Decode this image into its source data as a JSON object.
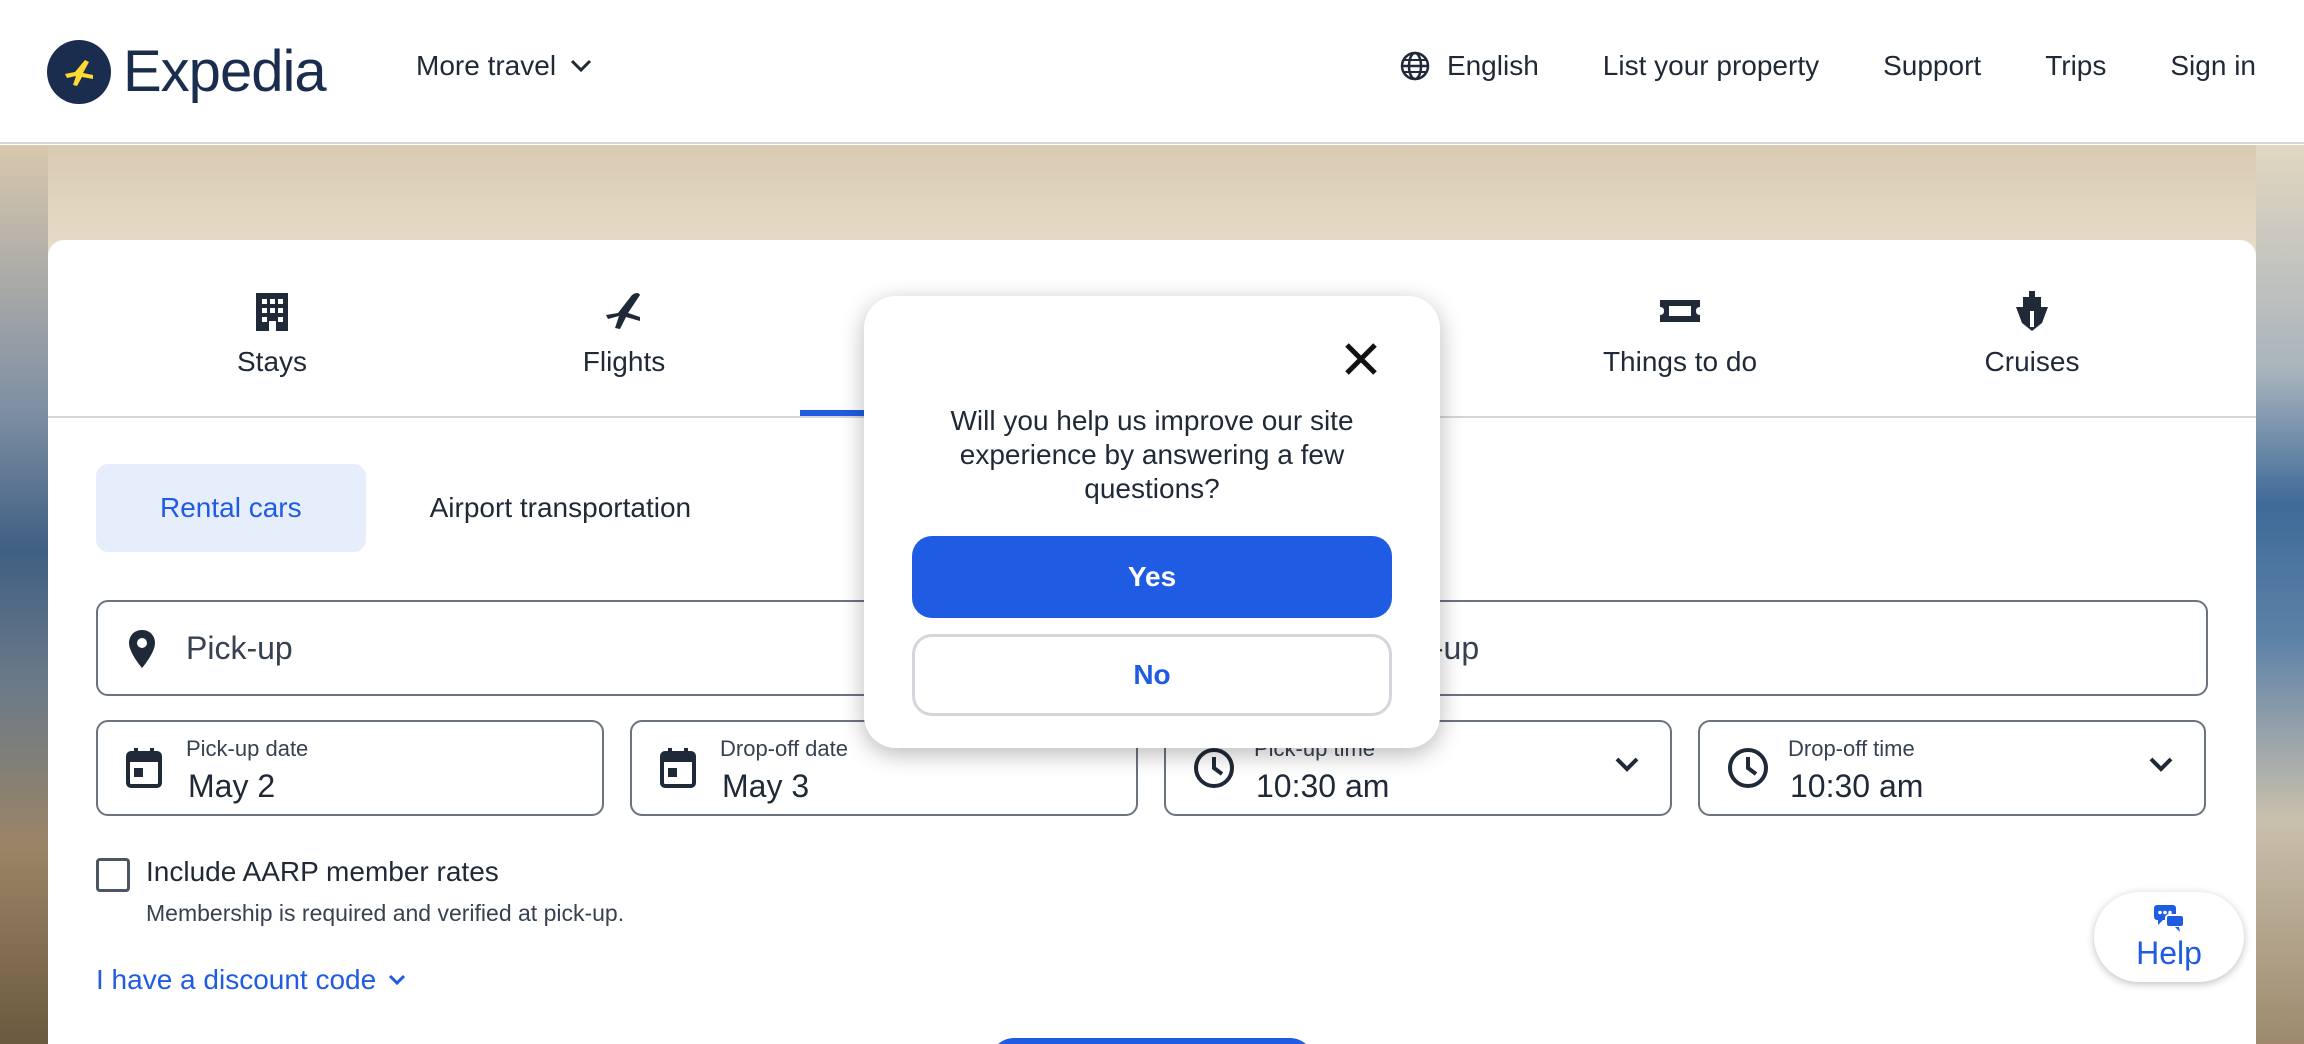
{
  "header": {
    "brand": "Expedia",
    "more_travel": "More travel",
    "language": "English",
    "list_property": "List your property",
    "support": "Support",
    "trips": "Trips",
    "sign_in": "Sign in"
  },
  "tabs": {
    "stays": "Stays",
    "flights": "Flights",
    "things_to_do": "Things to do",
    "cruises": "Cruises"
  },
  "subtabs": {
    "rental_cars": "Rental cars",
    "airport_transportation": "Airport transportation"
  },
  "form": {
    "pickup_location": "Pick-up",
    "dropoff_location_visible": "t-up",
    "pickup_date_label": "Pick-up date",
    "pickup_date_value": "May 2",
    "dropoff_date_label": "Drop-off date",
    "dropoff_date_value": "May 3",
    "pickup_time_label": "Pick-up time",
    "pickup_time_value": "10:30 am",
    "dropoff_time_label": "Drop-off time",
    "dropoff_time_value": "10:30 am",
    "aarp_label": "Include AARP member rates",
    "aarp_sub": "Membership is required and verified at pick-up.",
    "discount_link": "I have a discount code"
  },
  "help": {
    "label": "Help"
  },
  "modal": {
    "question": "Will you help us improve our site experience by answering a few questions?",
    "yes": "Yes",
    "no": "No"
  },
  "colors": {
    "accent": "#1f5ce3",
    "brand_navy": "#1b2d4f",
    "brand_yellow": "#fddb32"
  }
}
